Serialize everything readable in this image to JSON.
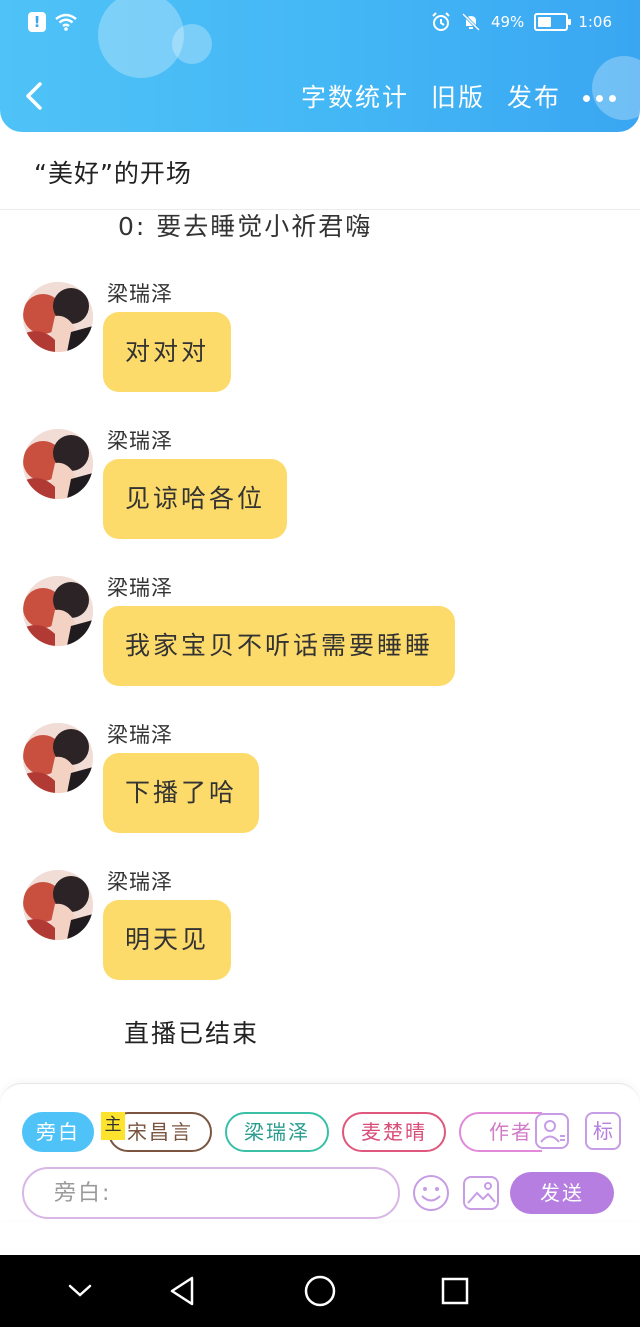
{
  "status_bar": {
    "alert": "!",
    "battery": "49%",
    "battery_level": 0.49,
    "time": "1:06"
  },
  "header": {
    "actions": [
      "字数统计",
      "旧版",
      "发布"
    ]
  },
  "title": "“美好”的开场",
  "partial_line": "0: 要去睡觉小祈君嗨",
  "messages": [
    {
      "sender": "梁瑞泽",
      "text": "对对对"
    },
    {
      "sender": "梁瑞泽",
      "text": "见谅哈各位"
    },
    {
      "sender": "梁瑞泽",
      "text": "我家宝贝不听话需要睡睡"
    },
    {
      "sender": "梁瑞泽",
      "text": "下播了哈"
    },
    {
      "sender": "梁瑞泽",
      "text": "明天见"
    }
  ],
  "system_note": "直播已结束",
  "composer": {
    "roles": [
      "旁白",
      "宋昌言",
      "梁瑞泽",
      "麦楚晴",
      "作者"
    ],
    "main_tag": "主",
    "input_placeholder": "旁白:",
    "send_label": "发送",
    "tag_button": "标"
  },
  "colors": {
    "header": "#42b5f5",
    "bubble": "#fddb6b",
    "send": "#b57ee0",
    "aside_chip": "#4fc3f7"
  },
  "icons": [
    "back-icon",
    "more-icon",
    "alarm-icon",
    "mute-icon",
    "wifi-icon",
    "user-card-icon",
    "emoji-icon",
    "image-icon"
  ]
}
